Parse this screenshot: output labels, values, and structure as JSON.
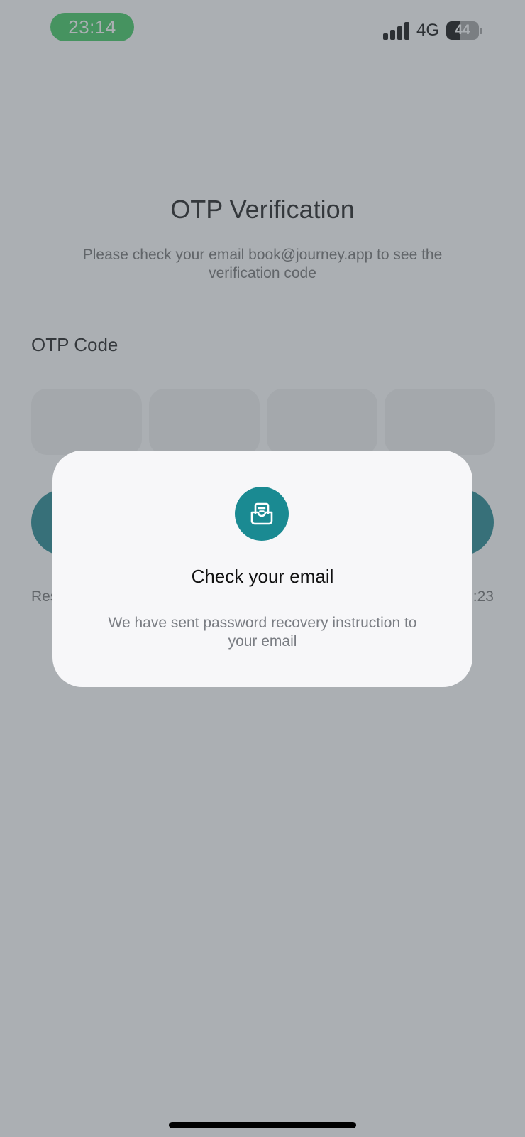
{
  "status_bar": {
    "time": "23:14",
    "network": "4G",
    "battery_level": "44",
    "signal_bars": 4,
    "time_pill_color": "#34c759"
  },
  "page": {
    "title": "OTP Verification",
    "subtitle": "Please check your email book@journey.app to see the verification code",
    "otp_label": "OTP Code",
    "otp_digits": [
      "",
      "",
      "",
      ""
    ],
    "verify_button_label": "",
    "resend_label": "Res",
    "timer": ":23",
    "accent_color": "#17808a"
  },
  "dialog": {
    "icon": "mail-inbox-icon",
    "title": "Check your email",
    "message": "We have sent password recovery instruction to your email",
    "icon_bg_color": "#1a8a92"
  }
}
